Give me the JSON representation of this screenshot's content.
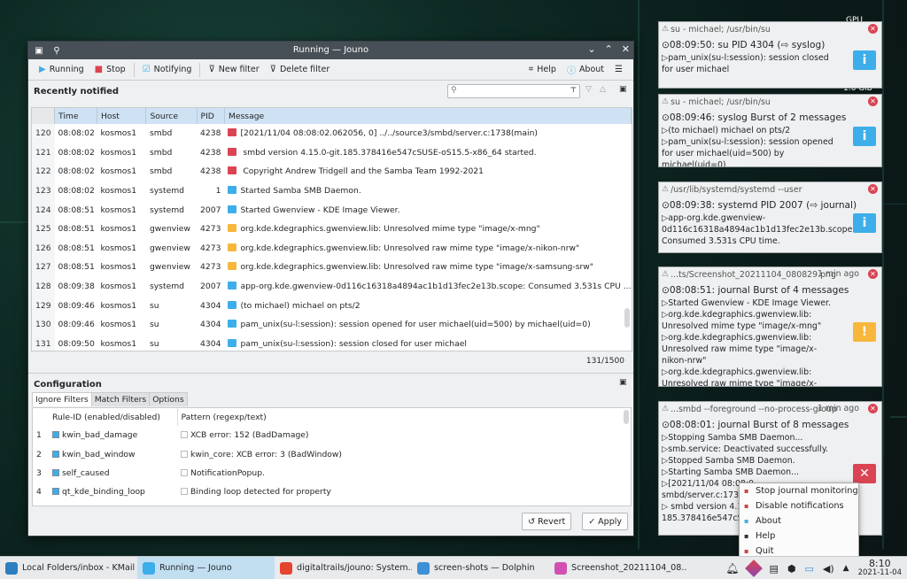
{
  "window": {
    "title": "Running — Jouno",
    "controls": [
      "⌄",
      "⌃",
      "✕"
    ]
  },
  "toolbar": {
    "running": "Running",
    "stop": "Stop",
    "notifying": "Notifying",
    "new_filter": "New filter",
    "delete_filter": "Delete filter",
    "help": "Help",
    "about": "About"
  },
  "recent": {
    "title": "Recently notified",
    "search_placeholder": "",
    "count": "131/1500",
    "headers": [
      "Time",
      "Host",
      "Source",
      "PID",
      "Message"
    ],
    "rows": [
      {
        "n": "120",
        "time": "08:08:02",
        "host": "kosmos1",
        "src": "smbd",
        "pid": "4238",
        "type": "error",
        "msg": "[2021/11/04 08:08:02.062056,  0] ../../source3/smbd/server.c:1738(main)"
      },
      {
        "n": "121",
        "time": "08:08:02",
        "host": "kosmos1",
        "src": "smbd",
        "pid": "4238",
        "type": "error",
        "msg": "  smbd version 4.15.0-git.185.378416e547cSUSE-oS15.5-x86_64 started."
      },
      {
        "n": "122",
        "time": "08:08:02",
        "host": "kosmos1",
        "src": "smbd",
        "pid": "4238",
        "type": "error",
        "msg": "  Copyright Andrew Tridgell and the Samba Team 1992-2021"
      },
      {
        "n": "123",
        "time": "08:08:02",
        "host": "kosmos1",
        "src": "systemd",
        "pid": "1",
        "type": "info",
        "msg": "Started Samba SMB Daemon."
      },
      {
        "n": "124",
        "time": "08:08:51",
        "host": "kosmos1",
        "src": "systemd",
        "pid": "2007",
        "type": "info",
        "msg": "Started Gwenview - KDE Image Viewer."
      },
      {
        "n": "125",
        "time": "08:08:51",
        "host": "kosmos1",
        "src": "gwenview",
        "pid": "4273",
        "type": "warn",
        "msg": "org.kde.kdegraphics.gwenview.lib: Unresolved mime type  \"image/x-mng\""
      },
      {
        "n": "126",
        "time": "08:08:51",
        "host": "kosmos1",
        "src": "gwenview",
        "pid": "4273",
        "type": "warn",
        "msg": "org.kde.kdegraphics.gwenview.lib: Unresolved raw mime type  \"image/x-nikon-nrw\""
      },
      {
        "n": "127",
        "time": "08:08:51",
        "host": "kosmos1",
        "src": "gwenview",
        "pid": "4273",
        "type": "warn",
        "msg": "org.kde.kdegraphics.gwenview.lib: Unresolved raw mime type  \"image/x-samsung-srw\""
      },
      {
        "n": "128",
        "time": "08:09:38",
        "host": "kosmos1",
        "src": "systemd",
        "pid": "2007",
        "type": "info",
        "msg": "app-org.kde.gwenview-0d116c16318a4894ac1b1d13fec2e13b.scope: Consumed 3.531s CPU ..."
      },
      {
        "n": "129",
        "time": "08:09:46",
        "host": "kosmos1",
        "src": "su",
        "pid": "4304",
        "type": "info",
        "msg": "(to michael) michael on pts/2"
      },
      {
        "n": "130",
        "time": "08:09:46",
        "host": "kosmos1",
        "src": "su",
        "pid": "4304",
        "type": "info",
        "msg": "pam_unix(su-l:session): session opened for user michael(uid=500) by michael(uid=0)"
      },
      {
        "n": "131",
        "time": "08:09:50",
        "host": "kosmos1",
        "src": "su",
        "pid": "4304",
        "type": "info",
        "msg": "pam_unix(su-l:session): session closed for user michael"
      }
    ]
  },
  "config": {
    "title": "Configuration",
    "tabs": [
      "Ignore Filters",
      "Match Filters",
      "Options"
    ],
    "headers": [
      "Rule-ID (enabled/disabled)",
      "Pattern (regexp/text)"
    ],
    "rows": [
      {
        "n": "1",
        "rule": "kwin_bad_damage",
        "pattern": "XCB error: 152 (BadDamage)"
      },
      {
        "n": "2",
        "rule": "kwin_bad_window",
        "pattern": "kwin_core: XCB error: 3 (BadWindow)"
      },
      {
        "n": "3",
        "rule": "self_caused",
        "pattern": "NotificationPopup."
      },
      {
        "n": "4",
        "rule": "qt_kde_binding_loop",
        "pattern": "Binding loop detected for property"
      }
    ],
    "revert": "Revert",
    "apply": "Apply"
  },
  "notifications": [
    {
      "head": "su - michael; /usr/bin/su",
      "age": "",
      "summary": "⊙08:09:50: su PID 4304 (⇨ syslog)",
      "lines": [
        "▷pam_unix(su-l:session): session closed for user michael"
      ],
      "icon": "info"
    },
    {
      "head": "su - michael; /usr/bin/su",
      "age": "",
      "summary": "⊙08:09:46: syslog Burst of 2 messages",
      "lines": [
        "▷(to michael) michael on pts/2",
        "▷pam_unix(su-l:session): session opened for user michael(uid=500) by michael(uid=0)"
      ],
      "icon": "info"
    },
    {
      "head": "/usr/lib/systemd/systemd --user",
      "age": "",
      "summary": "⊙08:09:38: systemd PID 2007 (⇨ journal)",
      "lines": [
        "▷app-org.kde.gwenview-0d116c16318a4894ac1b1d13fec2e13b.scope: Consumed 3.531s CPU time."
      ],
      "icon": "info"
    },
    {
      "head": "...ts/Screenshot_20211104_080829.png",
      "age": "1 min ago",
      "summary": "⊙08:08:51: journal Burst of 4 messages",
      "lines": [
        "▷Started Gwenview - KDE Image Viewer.",
        "▷org.kde.kdegraphics.gwenview.lib: Unresolved mime type \"image/x-mng\"",
        "▷org.kde.kdegraphics.gwenview.lib: Unresolved raw mime type \"image/x-nikon-nrw\"",
        "▷org.kde.kdegraphics.gwenview.lib: Unresolved raw mime type \"image/x-samsung-srw\""
      ],
      "icon": "warning"
    },
    {
      "head": "...smbd --foreground --no-process-group",
      "age": "1 min ago",
      "summary": "⊙08:08:01: journal Burst of 8 messages",
      "lines": [
        "▷Stopping Samba SMB Daemon...",
        "▷smb.service: Deactivated successfully.",
        "▷Stopped Samba SMB Daemon.",
        "▷Starting Samba SMB Daemon...",
        "▷[2021/11/04 08:08:0",
        "smbd/server.c:1738(",
        "▷ smbd version 4.15.",
        "185.378416e547cSUS"
      ],
      "icon": "error"
    }
  ],
  "context_menu": [
    "Stop journal monitoring",
    "Disable notifications",
    "About",
    "Help",
    "Quit"
  ],
  "desktop": {
    "gpu": "GPU",
    "mem": "1.6 GiB"
  },
  "taskbar": {
    "tasks": [
      {
        "label": "Local Folders/inbox - KMail",
        "color": "#2c7fc0"
      },
      {
        "label": "Running — Jouno",
        "color": "#3daee9"
      },
      {
        "label": "digitaltrails/jouno: System...",
        "color": "#e5452f"
      },
      {
        "label": "screen-shots — Dolphin",
        "color": "#3d8fd6"
      },
      {
        "label": "Screenshot_20211104_08...",
        "color": "#d14fb0"
      }
    ],
    "time": "8:10",
    "date": "2021-11-04"
  },
  "colors": {
    "error": "#da4453",
    "warn": "#f6b73c",
    "info": "#3daee9",
    "accent": "#3daee9"
  }
}
